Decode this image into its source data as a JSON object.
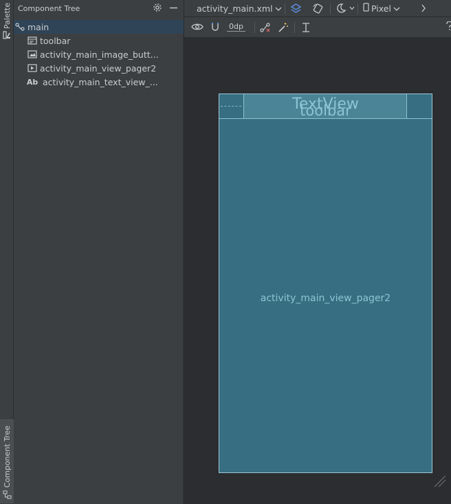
{
  "sidebar": {
    "palette_label": "Palette",
    "component_tree_label": "Component Tree"
  },
  "tree": {
    "title": "Component Tree",
    "items": [
      {
        "label": "main",
        "icon": "constraint-layout-icon",
        "level": 0
      },
      {
        "label": "toolbar",
        "icon": "toolbar-icon",
        "level": 1
      },
      {
        "label": "activity_main_image_butt...",
        "icon": "image-button-icon",
        "level": 1
      },
      {
        "label": "activity_main_view_pager2",
        "icon": "view-pager-icon",
        "level": 1
      },
      {
        "label": "activity_main_text_view_...",
        "icon": "text-view-icon",
        "icon_text": "Ab",
        "level": 1
      }
    ]
  },
  "design_toolbar": {
    "file_name": "activity_main.xml",
    "device": "Pixel",
    "margin_value": "0dp"
  },
  "device_preview": {
    "text_view_label": "TextView",
    "toolbar_label": "toolbar",
    "pager_label": "activity_main_view_pager2"
  },
  "colors": {
    "panel_bg": "#3c3f41",
    "canvas_bg": "#2b2d30",
    "selected_row": "#2f4457",
    "device_bg": "#376e82",
    "device_text": "#8ec4d4"
  }
}
